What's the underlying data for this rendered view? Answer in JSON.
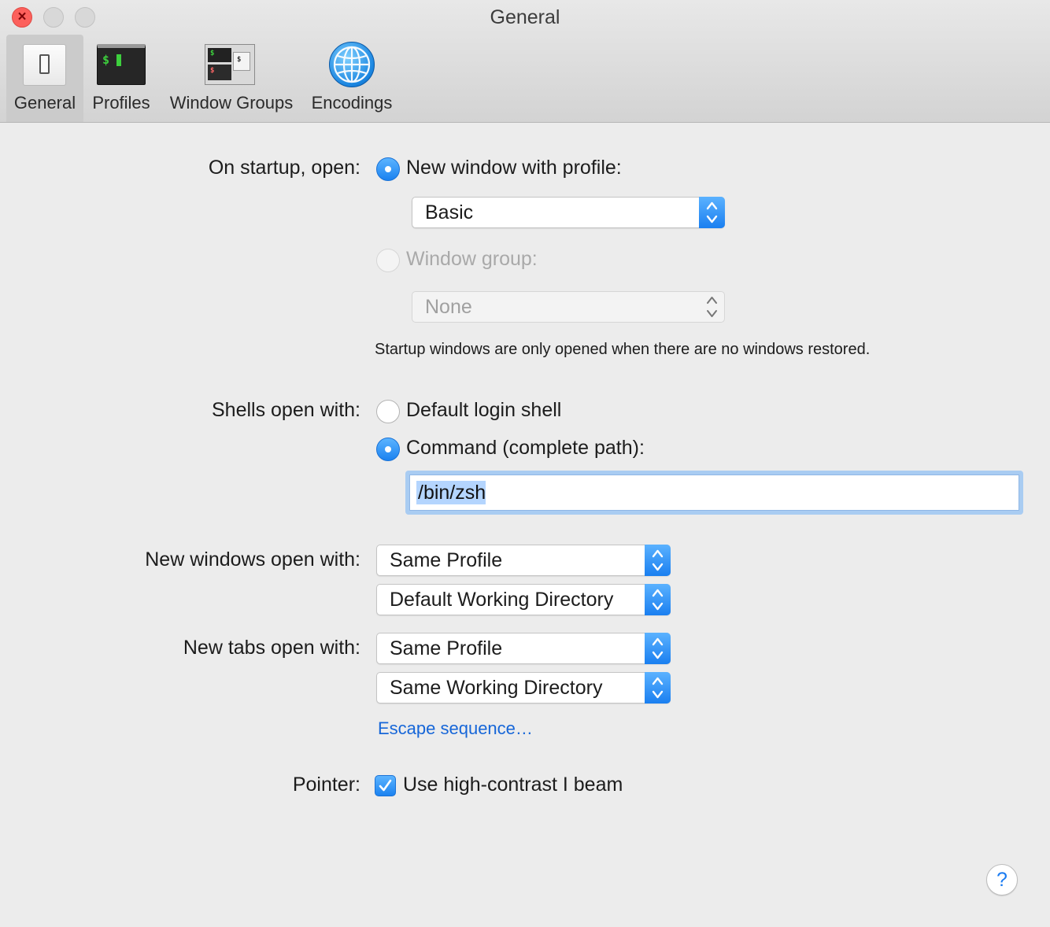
{
  "window": {
    "title": "General"
  },
  "toolbar": {
    "items": [
      {
        "label": "General",
        "icon": "general-switch-icon",
        "selected": true
      },
      {
        "label": "Profiles",
        "icon": "terminal-icon",
        "selected": false
      },
      {
        "label": "Window Groups",
        "icon": "window-groups-icon",
        "selected": false
      },
      {
        "label": "Encodings",
        "icon": "globe-icon",
        "selected": false
      }
    ],
    "icon_glyphs": {
      "prompt": "$"
    }
  },
  "startup": {
    "label": "On startup, open:",
    "new_window_option": "New window with profile:",
    "new_window_selected": true,
    "profile_value": "Basic",
    "window_group_option": "Window group:",
    "window_group_enabled": false,
    "window_group_value": "None",
    "note": "Startup windows are only opened when there are no windows restored."
  },
  "shells": {
    "label": "Shells open with:",
    "default_login_option": "Default login shell",
    "command_option": "Command (complete path):",
    "selected": "command",
    "command_value": "/bin/zsh"
  },
  "new_windows": {
    "label": "New windows open with:",
    "profile_value": "Same Profile",
    "directory_value": "Default Working Directory"
  },
  "new_tabs": {
    "label": "New tabs open with:",
    "profile_value": "Same Profile",
    "directory_value": "Same Working Directory",
    "escape_link": "Escape sequence…"
  },
  "pointer": {
    "label": "Pointer:",
    "option": "Use high-contrast I beam",
    "checked": true
  },
  "help": {
    "glyph": "?"
  },
  "colors": {
    "accent": "#1b82f0",
    "link": "#1666d8",
    "close_button": "#fc605c",
    "background": "#ececec"
  }
}
